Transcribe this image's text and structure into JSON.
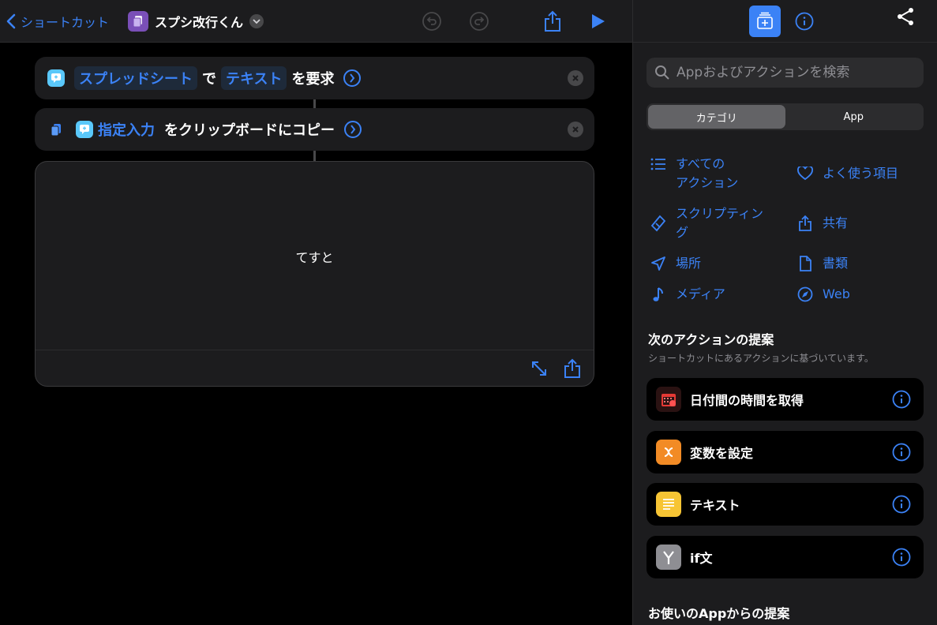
{
  "topbar": {
    "back_label": "ショートカット",
    "title": "スプシ改行くん"
  },
  "actions": [
    {
      "parts": [
        "スプレッドシート",
        "で",
        "テキスト",
        "を要求"
      ]
    },
    {
      "parts": [
        "指定入力",
        "をクリップボードにコピー"
      ]
    }
  ],
  "result": {
    "text": "てすと"
  },
  "panel": {
    "search_placeholder": "Appおよびアクションを検索",
    "segments": [
      "カテゴリ",
      "App"
    ],
    "categories": [
      {
        "label": "すべての\nアクション",
        "icon": "list-icon"
      },
      {
        "label": "よく使う項目",
        "icon": "heart-icon"
      },
      {
        "label": "スクリプティン\nグ",
        "icon": "scripting-icon"
      },
      {
        "label": "共有",
        "icon": "share-icon"
      },
      {
        "label": "場所",
        "icon": "location-icon"
      },
      {
        "label": "書類",
        "icon": "document-icon"
      },
      {
        "label": "メディア",
        "icon": "music-note-icon"
      },
      {
        "label": "Web",
        "icon": "compass-icon"
      }
    ],
    "next_title": "次のアクションの提案",
    "next_sub": "ショートカットにあるアクションに基づいています。",
    "suggestions": [
      {
        "label": "日付間の時間を取得",
        "icon": "calendar-icon",
        "color": "#2a1212"
      },
      {
        "label": "変数を設定",
        "icon": "variable-icon",
        "color": "#f28b25"
      },
      {
        "label": "テキスト",
        "icon": "text-icon",
        "color": "#f7c534"
      },
      {
        "label": "if文",
        "icon": "branch-icon",
        "color": "#8e8e93"
      }
    ],
    "apps_title": "お使いのAppからの提案"
  },
  "colors": {
    "accent": "#3b82f6",
    "background": "#000000",
    "surface": "#1c1c1e"
  }
}
